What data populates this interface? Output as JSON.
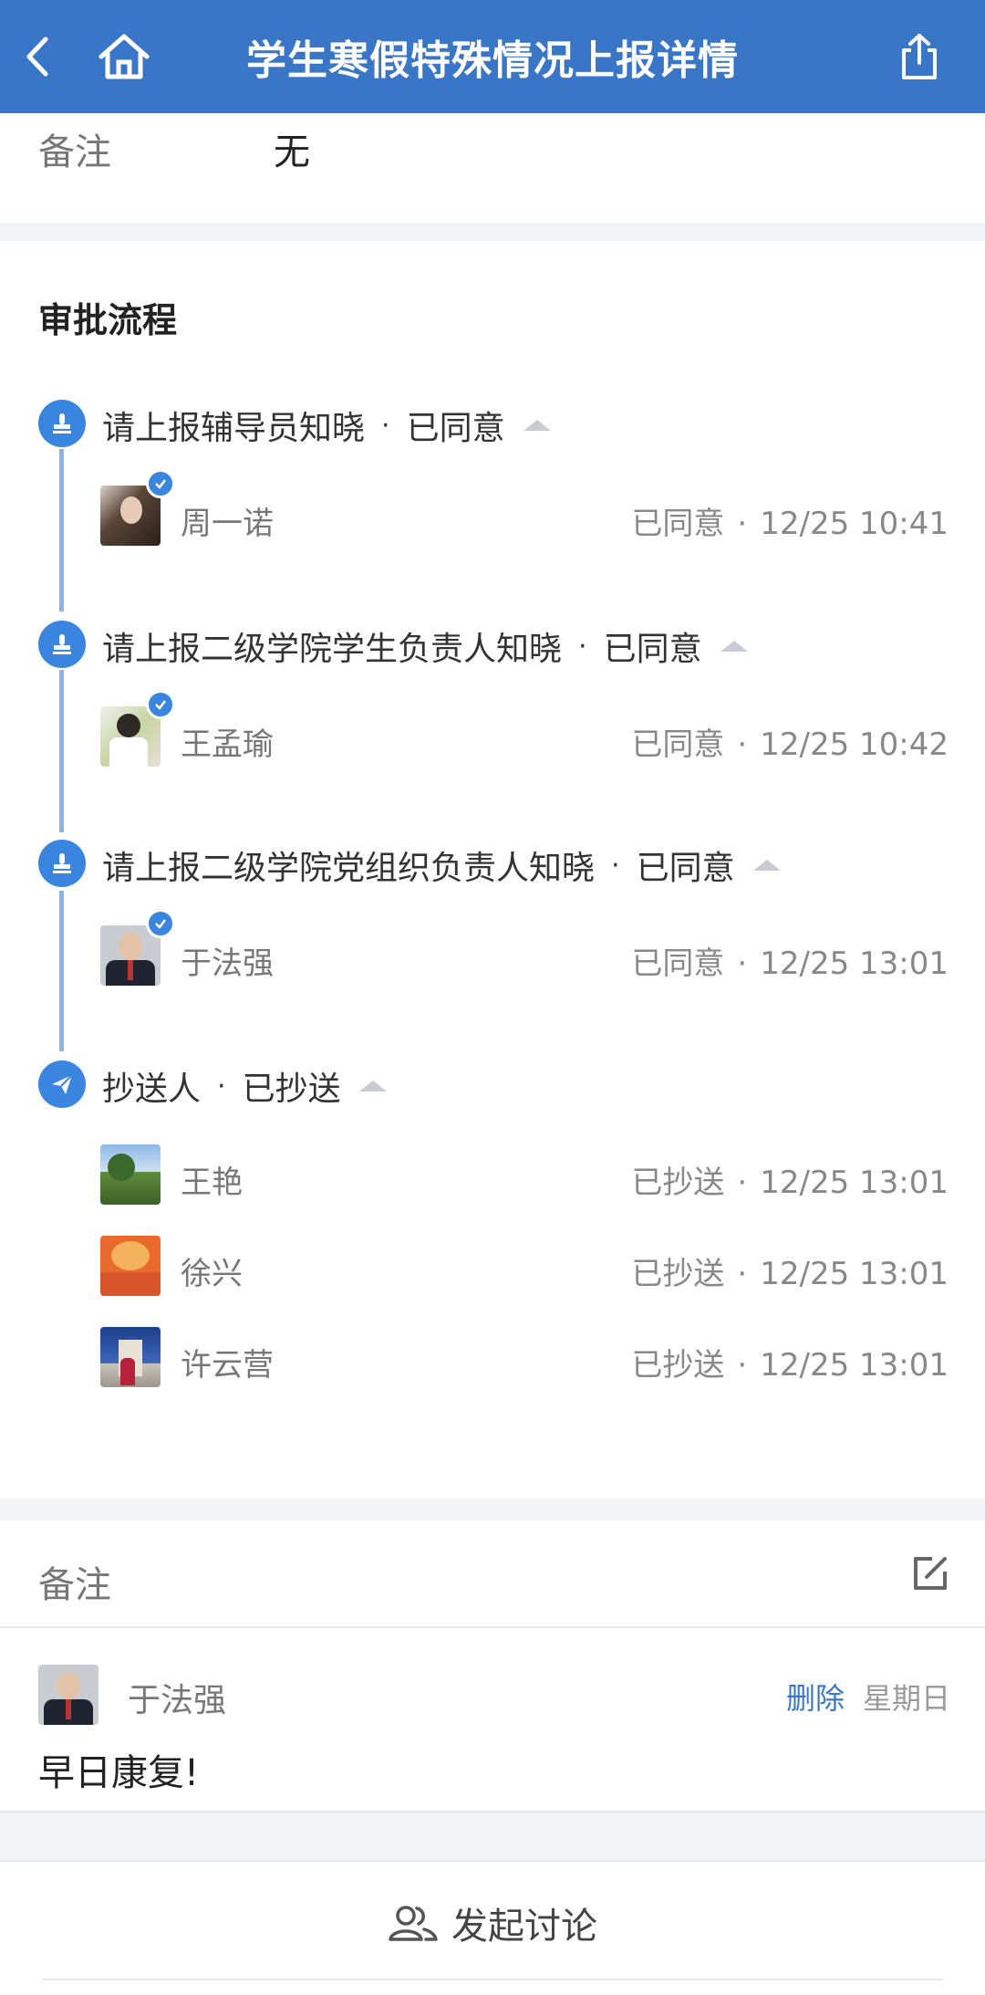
{
  "header": {
    "title": "学生寒假特殊情况上报详情"
  },
  "remark": {
    "label": "备注",
    "value": "无"
  },
  "flow": {
    "title": "审批流程",
    "steps": [
      {
        "title": "请上报辅导员知晓",
        "status": "已同意",
        "people": [
          {
            "name": "周一诺",
            "status": "已同意",
            "time": "12/25 10:41"
          }
        ]
      },
      {
        "title": "请上报二级学院学生负责人知晓",
        "status": "已同意",
        "people": [
          {
            "name": "王孟瑜",
            "status": "已同意",
            "time": "12/25 10:42"
          }
        ]
      },
      {
        "title": "请上报二级学院党组织负责人知晓",
        "status": "已同意",
        "people": [
          {
            "name": "于法强",
            "status": "已同意",
            "time": "12/25 13:01"
          }
        ]
      },
      {
        "title": "抄送人",
        "status": "已抄送",
        "people": [
          {
            "name": "王艳",
            "status": "已抄送",
            "time": "12/25 13:01"
          },
          {
            "name": "徐兴",
            "status": "已抄送",
            "time": "12/25 13:01"
          },
          {
            "name": "许云营",
            "status": "已抄送",
            "time": "12/25 13:01"
          }
        ]
      }
    ]
  },
  "notes": {
    "label": "备注",
    "comment": {
      "author": "于法强",
      "delete_label": "删除",
      "date": "星期日",
      "text": "早日康复!"
    }
  },
  "discuss": {
    "label": "发起讨论"
  },
  "dot": "·",
  "colors": {
    "header": "#3a76c8",
    "accent": "#3a85e0",
    "timeline": "#8cb4e4"
  },
  "icons": [
    "back-icon",
    "home-icon",
    "share-icon",
    "approver-stamp-icon",
    "paper-plane-icon",
    "check-badge-icon",
    "edit-icon",
    "people-icon"
  ]
}
